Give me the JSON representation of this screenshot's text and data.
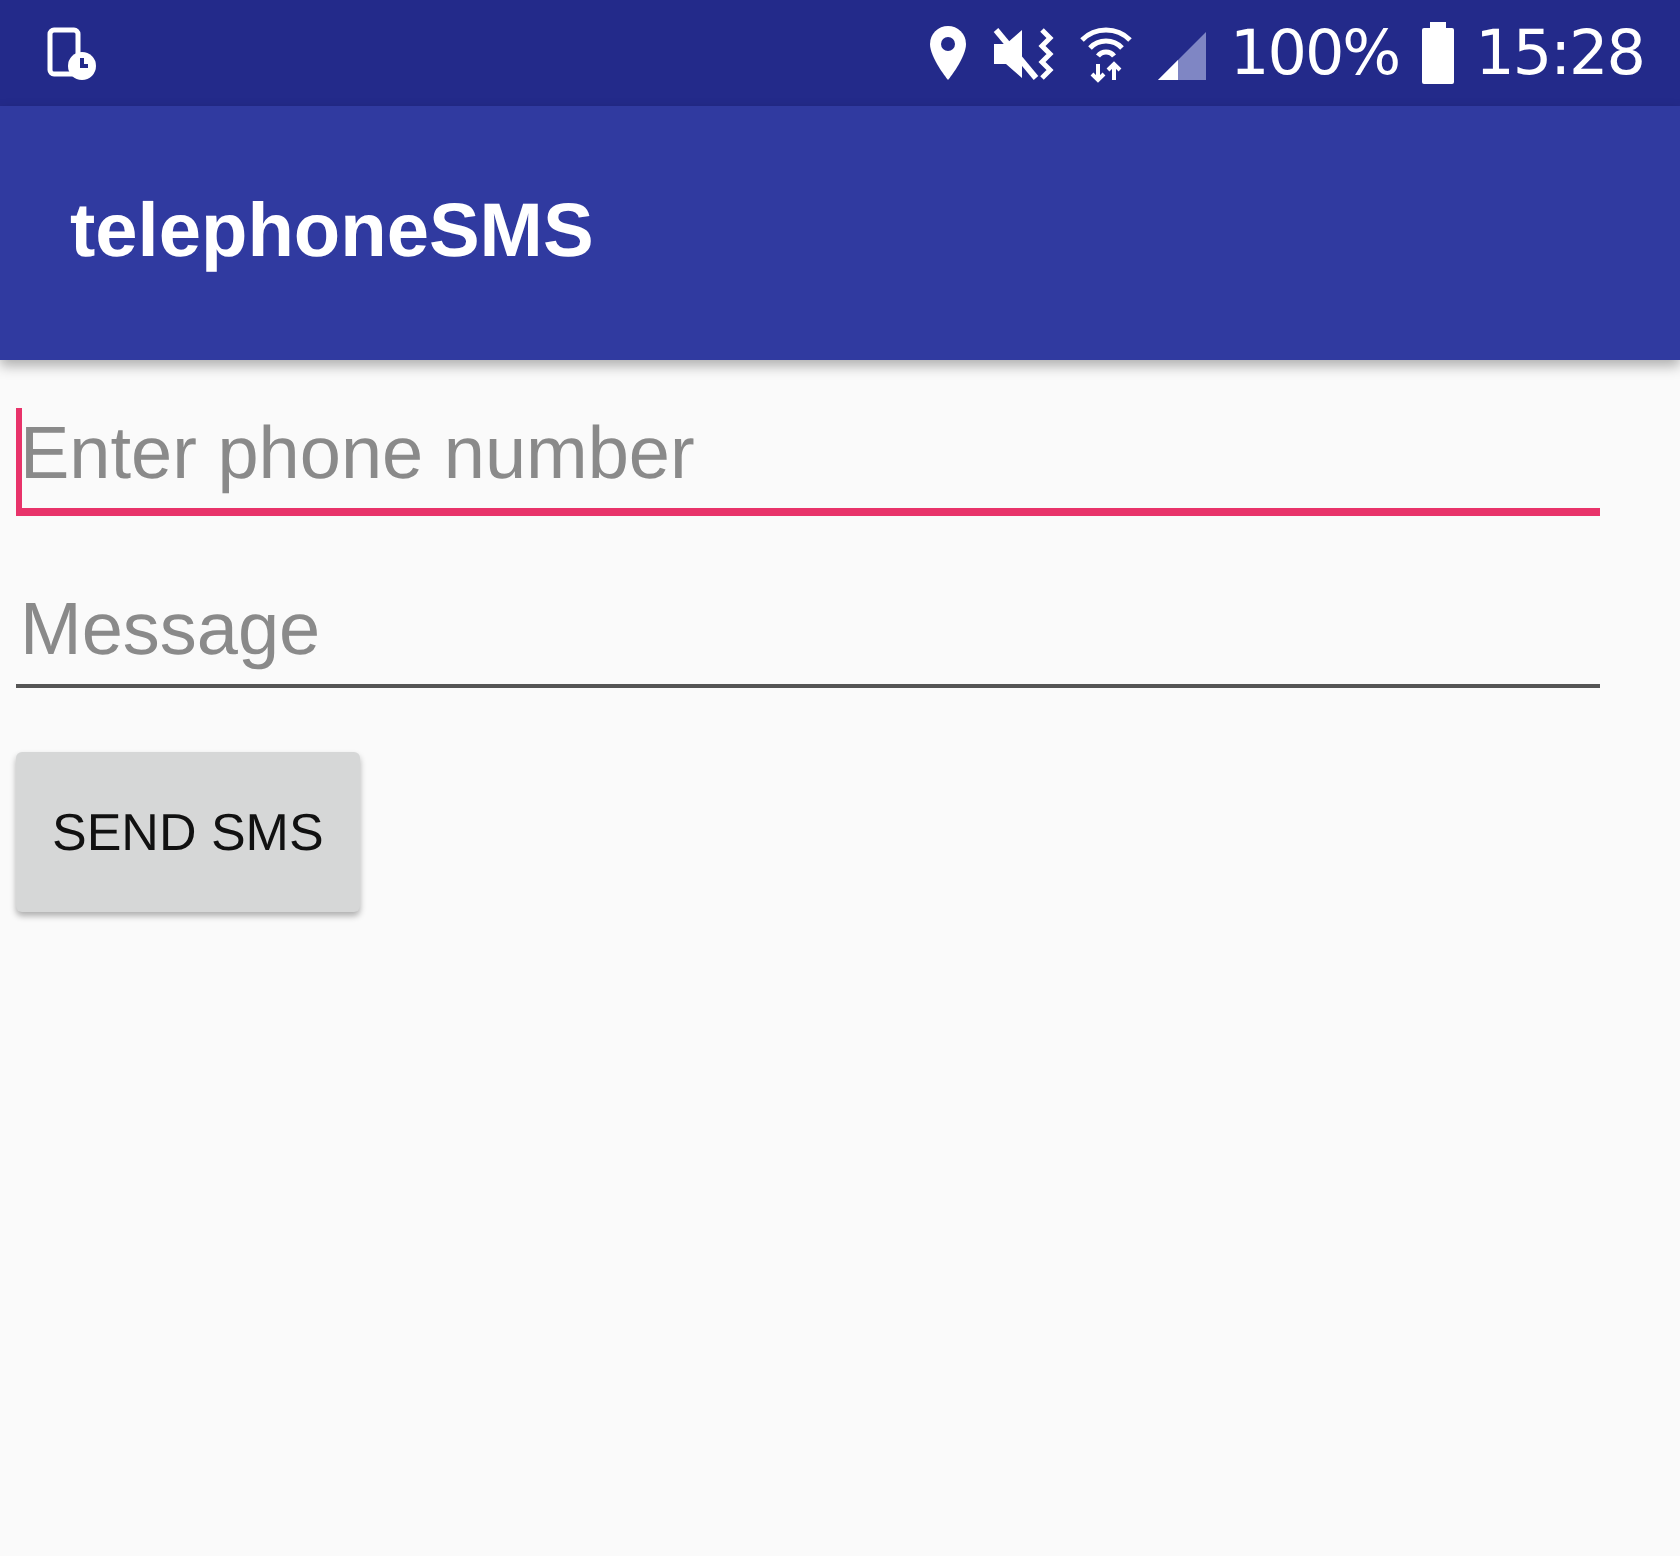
{
  "status_bar": {
    "battery": "100%",
    "time": "15:28"
  },
  "app_bar": {
    "title": "telephoneSMS"
  },
  "fields": [
    {
      "placeholder": "Enter phone number",
      "focused": true
    },
    {
      "placeholder": "Message",
      "focused": false
    }
  ],
  "button": {
    "label": "SEND SMS"
  }
}
